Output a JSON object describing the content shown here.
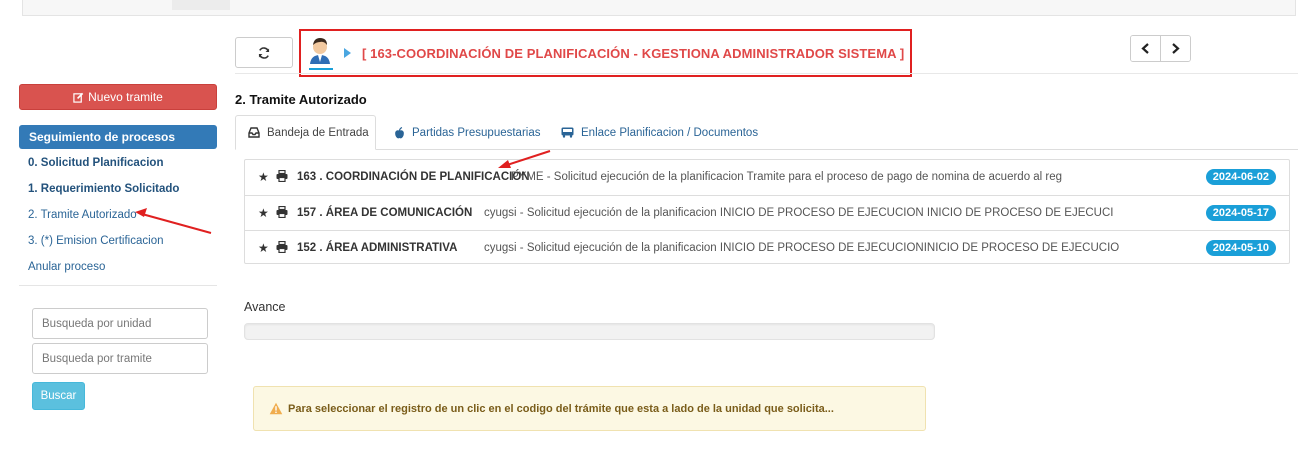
{
  "header": {
    "user_title": "[ 163-COORDINACIÓN DE PLANIFICACIÓN - KGESTIONA ADMINISTRADOR SISTEMA ]"
  },
  "sidebar": {
    "new_button": "Nuevo tramite",
    "panel_title": "Seguimiento de procesos",
    "links": [
      "0. Solicitud Planificacion",
      "1. Requerimiento Solicitado",
      "2. Tramite Autorizado",
      "3. (*) Emision Certificacion",
      "Anular proceso"
    ],
    "search_unit_placeholder": "Busqueda por unidad",
    "search_tramite_placeholder": "Busqueda por tramite",
    "search_button": "Buscar"
  },
  "main": {
    "section_title": "2. Tramite Autorizado",
    "tabs": [
      "Bandeja de Entrada",
      "Partidas Presupuestarias",
      "Enlace Planificacion / Documentos"
    ],
    "rows": [
      {
        "unit": "163 . COORDINACIÓN DE PLANIFICACIÓN",
        "description": "PYME - Solicitud ejecución de la planificacion Tramite para el proceso de pago de nomina de acuerdo al reg",
        "date": "2024-06-02"
      },
      {
        "unit": "157 . ÁREA DE COMUNICACIÓN",
        "description": "cyugsi - Solicitud ejecución de la planificacion INICIO DE PROCESO DE EJECUCION INICIO DE PROCESO DE EJECUCI",
        "date": "2024-05-17"
      },
      {
        "unit": "152 . ÁREA ADMINISTRATIVA",
        "description": "cyugsi - Solicitud ejecución de la planificacion INICIO DE PROCESO DE EJECUCIONINICIO DE PROCESO DE EJECUCIO",
        "date": "2024-05-10"
      }
    ],
    "avance_label": "Avance",
    "avance_progress": 0,
    "alert_text": "Para seleccionar el registro de un clic en el codigo del trámite que esta a lado de la unidad que solicita..."
  },
  "colors": {
    "accent_red": "#d9534f",
    "primary_blue": "#337ab7",
    "badge_blue": "#1a9fd8",
    "info_cyan": "#5bc0de",
    "annotation_red": "#e02020"
  }
}
